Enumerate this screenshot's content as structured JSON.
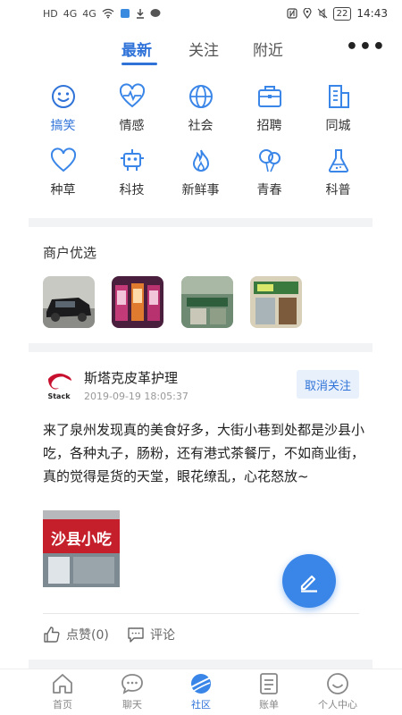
{
  "status_bar": {
    "left_indicators": [
      "HD",
      "4G",
      "4G"
    ],
    "battery": "22",
    "time": "14:43"
  },
  "top_tabs": [
    {
      "label": "最新",
      "active": true
    },
    {
      "label": "关注",
      "active": false
    },
    {
      "label": "附近",
      "active": false
    }
  ],
  "more_label": "•••",
  "categories": [
    {
      "label": "搞笑",
      "icon": "smile-icon",
      "active": true
    },
    {
      "label": "情感",
      "icon": "heartbeat-icon",
      "active": false
    },
    {
      "label": "社会",
      "icon": "globe-icon",
      "active": false
    },
    {
      "label": "招聘",
      "icon": "briefcase-icon",
      "active": false
    },
    {
      "label": "同城",
      "icon": "building-icon",
      "active": false
    },
    {
      "label": "种草",
      "icon": "heart-icon",
      "active": false
    },
    {
      "label": "科技",
      "icon": "robot-icon",
      "active": false
    },
    {
      "label": "新鲜事",
      "icon": "flame-icon",
      "active": false
    },
    {
      "label": "青春",
      "icon": "balloons-icon",
      "active": false
    },
    {
      "label": "科普",
      "icon": "flask-icon",
      "active": false
    }
  ],
  "merchant": {
    "title": "商户优选",
    "thumbs": [
      "car-photo",
      "arcade-photo",
      "restaurant-photo",
      "storefront-photo"
    ]
  },
  "post": {
    "author": "斯塔克皮革护理",
    "time": "2019-09-19 18:05:37",
    "unfollow_label": "取消关注",
    "body": "来了泉州发现真的美食好多，大街小巷到处都是沙县小吃，各种丸子，肠粉，还有港式茶餐厅，不如商业街，真的觉得是货的天堂，眼花缭乱，心花怒放~",
    "image_sign_text": "沙县小吃",
    "avatar_text": "Stack",
    "like_label": "点赞(0)",
    "comment_label": "评论"
  },
  "bottom_nav": [
    {
      "label": "首页",
      "icon": "home-icon",
      "active": false
    },
    {
      "label": "聊天",
      "icon": "chat-icon",
      "active": false
    },
    {
      "label": "社区",
      "icon": "planet-icon",
      "active": true
    },
    {
      "label": "账单",
      "icon": "bill-icon",
      "active": false
    },
    {
      "label": "个人中心",
      "icon": "profile-icon",
      "active": false
    }
  ],
  "colors": {
    "accent": "#2f73d9",
    "fab": "#3a86e8"
  }
}
